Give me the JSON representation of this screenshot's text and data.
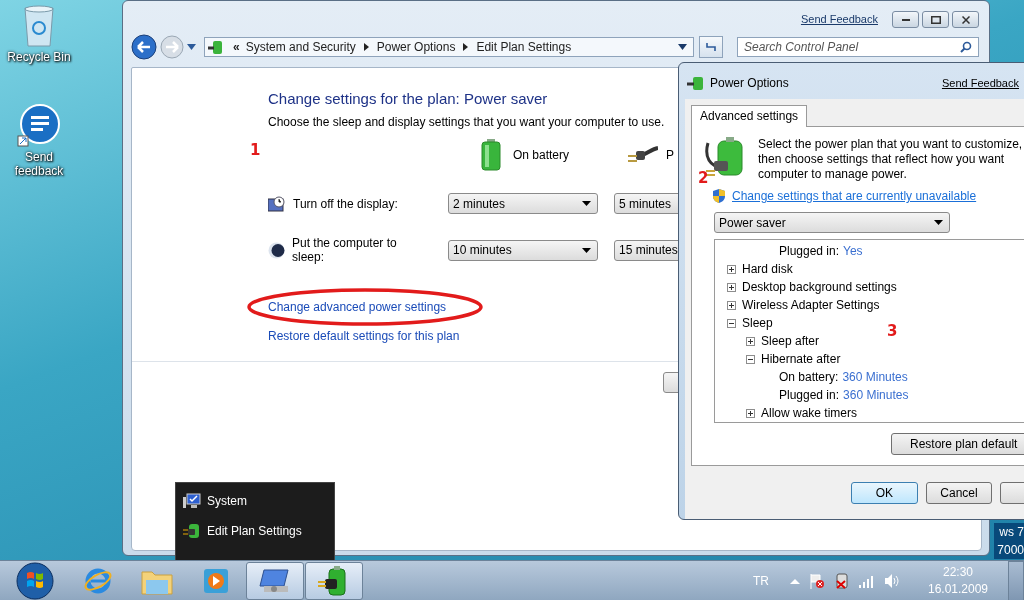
{
  "desktop_icons": [
    {
      "kind": "recycle",
      "label": "Recycle Bin"
    },
    {
      "kind": "feedback",
      "label": "Send feedback"
    }
  ],
  "wallpaper_text": [
    "ws 7",
    "7000"
  ],
  "main_window": {
    "send_feedback": "Send Feedback",
    "breadcrumb": {
      "overflow": "«",
      "items": [
        "System and Security",
        "Power Options",
        "Edit Plan Settings"
      ]
    },
    "search": {
      "placeholder": "Search Control Panel"
    },
    "heading": "Change settings for the plan: Power saver",
    "description": "Choose the sleep and display settings that you want your computer to use.",
    "annotation": "1",
    "columns": [
      {
        "kind": "battery",
        "label": "On battery"
      },
      {
        "kind": "plug",
        "label": "P"
      }
    ],
    "settings": [
      {
        "kind": "display",
        "label": "Turn off the display:",
        "values": [
          "2 minutes",
          "5 minutes"
        ]
      },
      {
        "kind": "sleep",
        "label": "Put the computer to sleep:",
        "values": [
          "10 minutes",
          "15 minutes"
        ]
      }
    ],
    "links": [
      {
        "text": "Change advanced power settings",
        "circled": true
      },
      {
        "text": "Restore default settings for this plan",
        "circled": false
      }
    ]
  },
  "dialog": {
    "title": "Power Options",
    "send_feedback": "Send Feedback",
    "tabs": [
      {
        "label": "Advanced settings",
        "selected": true
      }
    ],
    "intro": [
      "Select the power plan that you want to customize,",
      "then choose settings that reflect how you want",
      "computer to manage power."
    ],
    "annotation": "2",
    "admin_link": "Change settings that are currently unavailable",
    "plan": "Power saver",
    "tree_annotation": "3",
    "partial_row": {
      "label": "Plugged in:",
      "value": "Yes"
    },
    "tree": [
      {
        "kind": "group",
        "label": "Hard disk",
        "expanded": false
      },
      {
        "kind": "group",
        "label": "Desktop background settings",
        "expanded": false
      },
      {
        "kind": "group",
        "label": "Wireless Adapter Settings",
        "expanded": false
      },
      {
        "kind": "group",
        "label": "Sleep",
        "expanded": true,
        "children": [
          {
            "kind": "group",
            "label": "Sleep after",
            "expanded": false
          },
          {
            "kind": "group",
            "label": "Hibernate after",
            "expanded": true,
            "children": [
              {
                "kind": "value",
                "label": "On battery:",
                "value": "360 Minutes"
              },
              {
                "kind": "value",
                "label": "Plugged in:",
                "value": "360 Minutes"
              }
            ]
          },
          {
            "kind": "group",
            "label": "Allow wake timers",
            "expanded": false
          }
        ]
      }
    ],
    "restore": "Restore plan default",
    "buttons": [
      "OK",
      "Cancel"
    ]
  },
  "jump_list": [
    {
      "kind": "system",
      "label": "System"
    },
    {
      "kind": "power",
      "label": "Edit Plan Settings"
    }
  ],
  "taskbar": {
    "apps": [
      {
        "kind": "ie",
        "active": false
      },
      {
        "kind": "folder",
        "active": false
      },
      {
        "kind": "media",
        "active": false
      },
      {
        "kind": "control",
        "active": true
      },
      {
        "kind": "power",
        "active": true
      }
    ],
    "language": "TR",
    "time": "22:30",
    "date": "16.01.2009"
  }
}
